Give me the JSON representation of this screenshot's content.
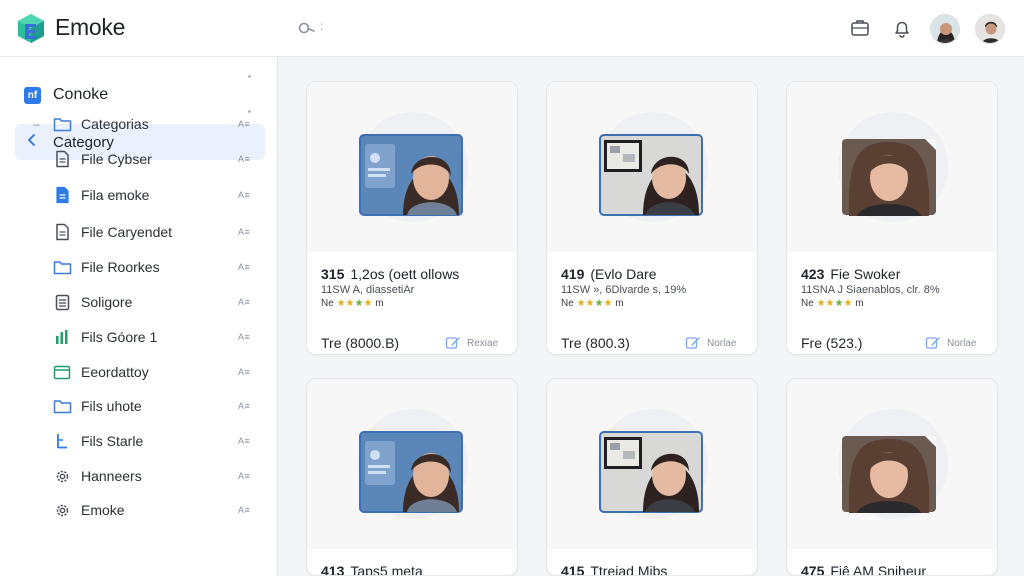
{
  "app": {
    "title": "Emoke"
  },
  "colors": {
    "accent": "#2f7be6",
    "active_bg": "#eaf1fd",
    "star": "#e3b21b"
  },
  "header": {
    "search_icon": "search-icon",
    "search_hint": ":",
    "tools": [
      "briefcase-icon",
      "bell-icon"
    ],
    "avatars": [
      "user-avatar",
      "user-avatar-secondary"
    ]
  },
  "sidebar": {
    "workspace_label": "Conoke",
    "active_label": "Category",
    "items": [
      {
        "label": "Categorias",
        "icon": "folder-icon",
        "aux": "A≡",
        "tree": "–"
      },
      {
        "label": "File Cybser",
        "icon": "file-icon",
        "aux": "A≡"
      },
      {
        "label": "Fila emoke",
        "icon": "file-blue-icon",
        "aux": "A≡"
      },
      {
        "label": "File Caryendet",
        "icon": "file-icon",
        "aux": "A≡"
      },
      {
        "label": "File Roorkes",
        "icon": "folder-icon",
        "aux": "A≡"
      },
      {
        "label": "Soligore",
        "icon": "doc-lines-icon",
        "aux": "A≡"
      },
      {
        "label": "Fils Góore 1",
        "icon": "bar-chart-icon",
        "aux": "A≡"
      },
      {
        "label": "Eeordattoy",
        "icon": "calendar-icon",
        "aux": "A≡"
      },
      {
        "label": "Fils uhote",
        "icon": "folder-icon",
        "aux": "A≡"
      },
      {
        "label": "Fils Starle",
        "icon": "timeline-icon",
        "aux": "A≡"
      },
      {
        "label": "Hanneers",
        "icon": "gear-icon",
        "aux": "A≡"
      },
      {
        "label": "Emoke",
        "icon": "gear-icon",
        "aux": "A≡"
      }
    ]
  },
  "cards": [
    {
      "id": "315",
      "name": "1,2os (oett ollows",
      "sub": "11SW A, diassetiAr",
      "rating_prefix": "Ne",
      "rating_suffix": "m",
      "price": "Tre (8000.B)",
      "action": "Rexiae"
    },
    {
      "id": "419",
      "name": "(Evlo Dare",
      "sub": "11SW », 6Dlvarde s, 19%",
      "rating_prefix": "Ne",
      "rating_suffix": "m",
      "price": "Tre (800.3)",
      "action": "Norlae"
    },
    {
      "id": "423",
      "name": "Fie Swoker",
      "sub": "11SNA J Siaenablos, clr. 8%",
      "rating_prefix": "Ne",
      "rating_suffix": "m",
      "price": "Fre (523.)",
      "action": "Norlae"
    },
    {
      "id": "413",
      "name": "Taps5 meta",
      "sub": "",
      "rating_prefix": "",
      "rating_suffix": "",
      "price": "",
      "action": ""
    },
    {
      "id": "415",
      "name": "Ttreiad Mibs",
      "sub": "",
      "rating_prefix": "",
      "rating_suffix": "",
      "price": "",
      "action": ""
    },
    {
      "id": "475",
      "name": "Fiê AM Sniheur",
      "sub": "",
      "rating_prefix": "",
      "rating_suffix": "",
      "price": "",
      "action": ""
    }
  ]
}
